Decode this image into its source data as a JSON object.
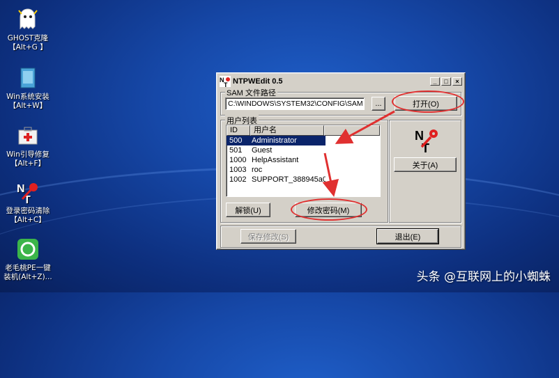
{
  "desktop": {
    "icons": [
      {
        "name": "GHOST克隆",
        "shortcut": "【Alt+G 】"
      },
      {
        "name": "Win系统安装",
        "shortcut": "【Alt+W】"
      },
      {
        "name": "Win引导修复",
        "shortcut": "【Alt+F】"
      },
      {
        "name": "登录密码清除",
        "shortcut": "【Alt+C】"
      },
      {
        "name": "老毛桃PE一键",
        "shortcut": "装机(Alt+Z)..."
      }
    ]
  },
  "window": {
    "title": "NTPWEdit 0.5",
    "controls": {
      "minimize": "_",
      "maximize": "□",
      "close": "×"
    },
    "sam_group": {
      "label": "SAM 文件路径",
      "path": "C:\\WINDOWS\\SYSTEM32\\CONFIG\\SAM",
      "browse": "...",
      "open": "打开(O)"
    },
    "users_group": {
      "label": "用户列表",
      "columns": [
        "ID",
        "用户名"
      ],
      "rows": [
        {
          "id": "500",
          "name": "Administrator"
        },
        {
          "id": "501",
          "name": "Guest"
        },
        {
          "id": "1000",
          "name": "HelpAssistant"
        },
        {
          "id": "1003",
          "name": "roc"
        },
        {
          "id": "1002",
          "name": "SUPPORT_388945a0"
        }
      ],
      "selected_index": 0,
      "unlock": "解锁(U)",
      "change_password": "修改密码(M)"
    },
    "about": "关于(A)",
    "save": "保存修改(S)",
    "exit": "退出(E)"
  },
  "watermark": "头条 @互联网上的小蜘蛛",
  "colors": {
    "annotation": "#e03030",
    "selection": "#0a246a"
  }
}
